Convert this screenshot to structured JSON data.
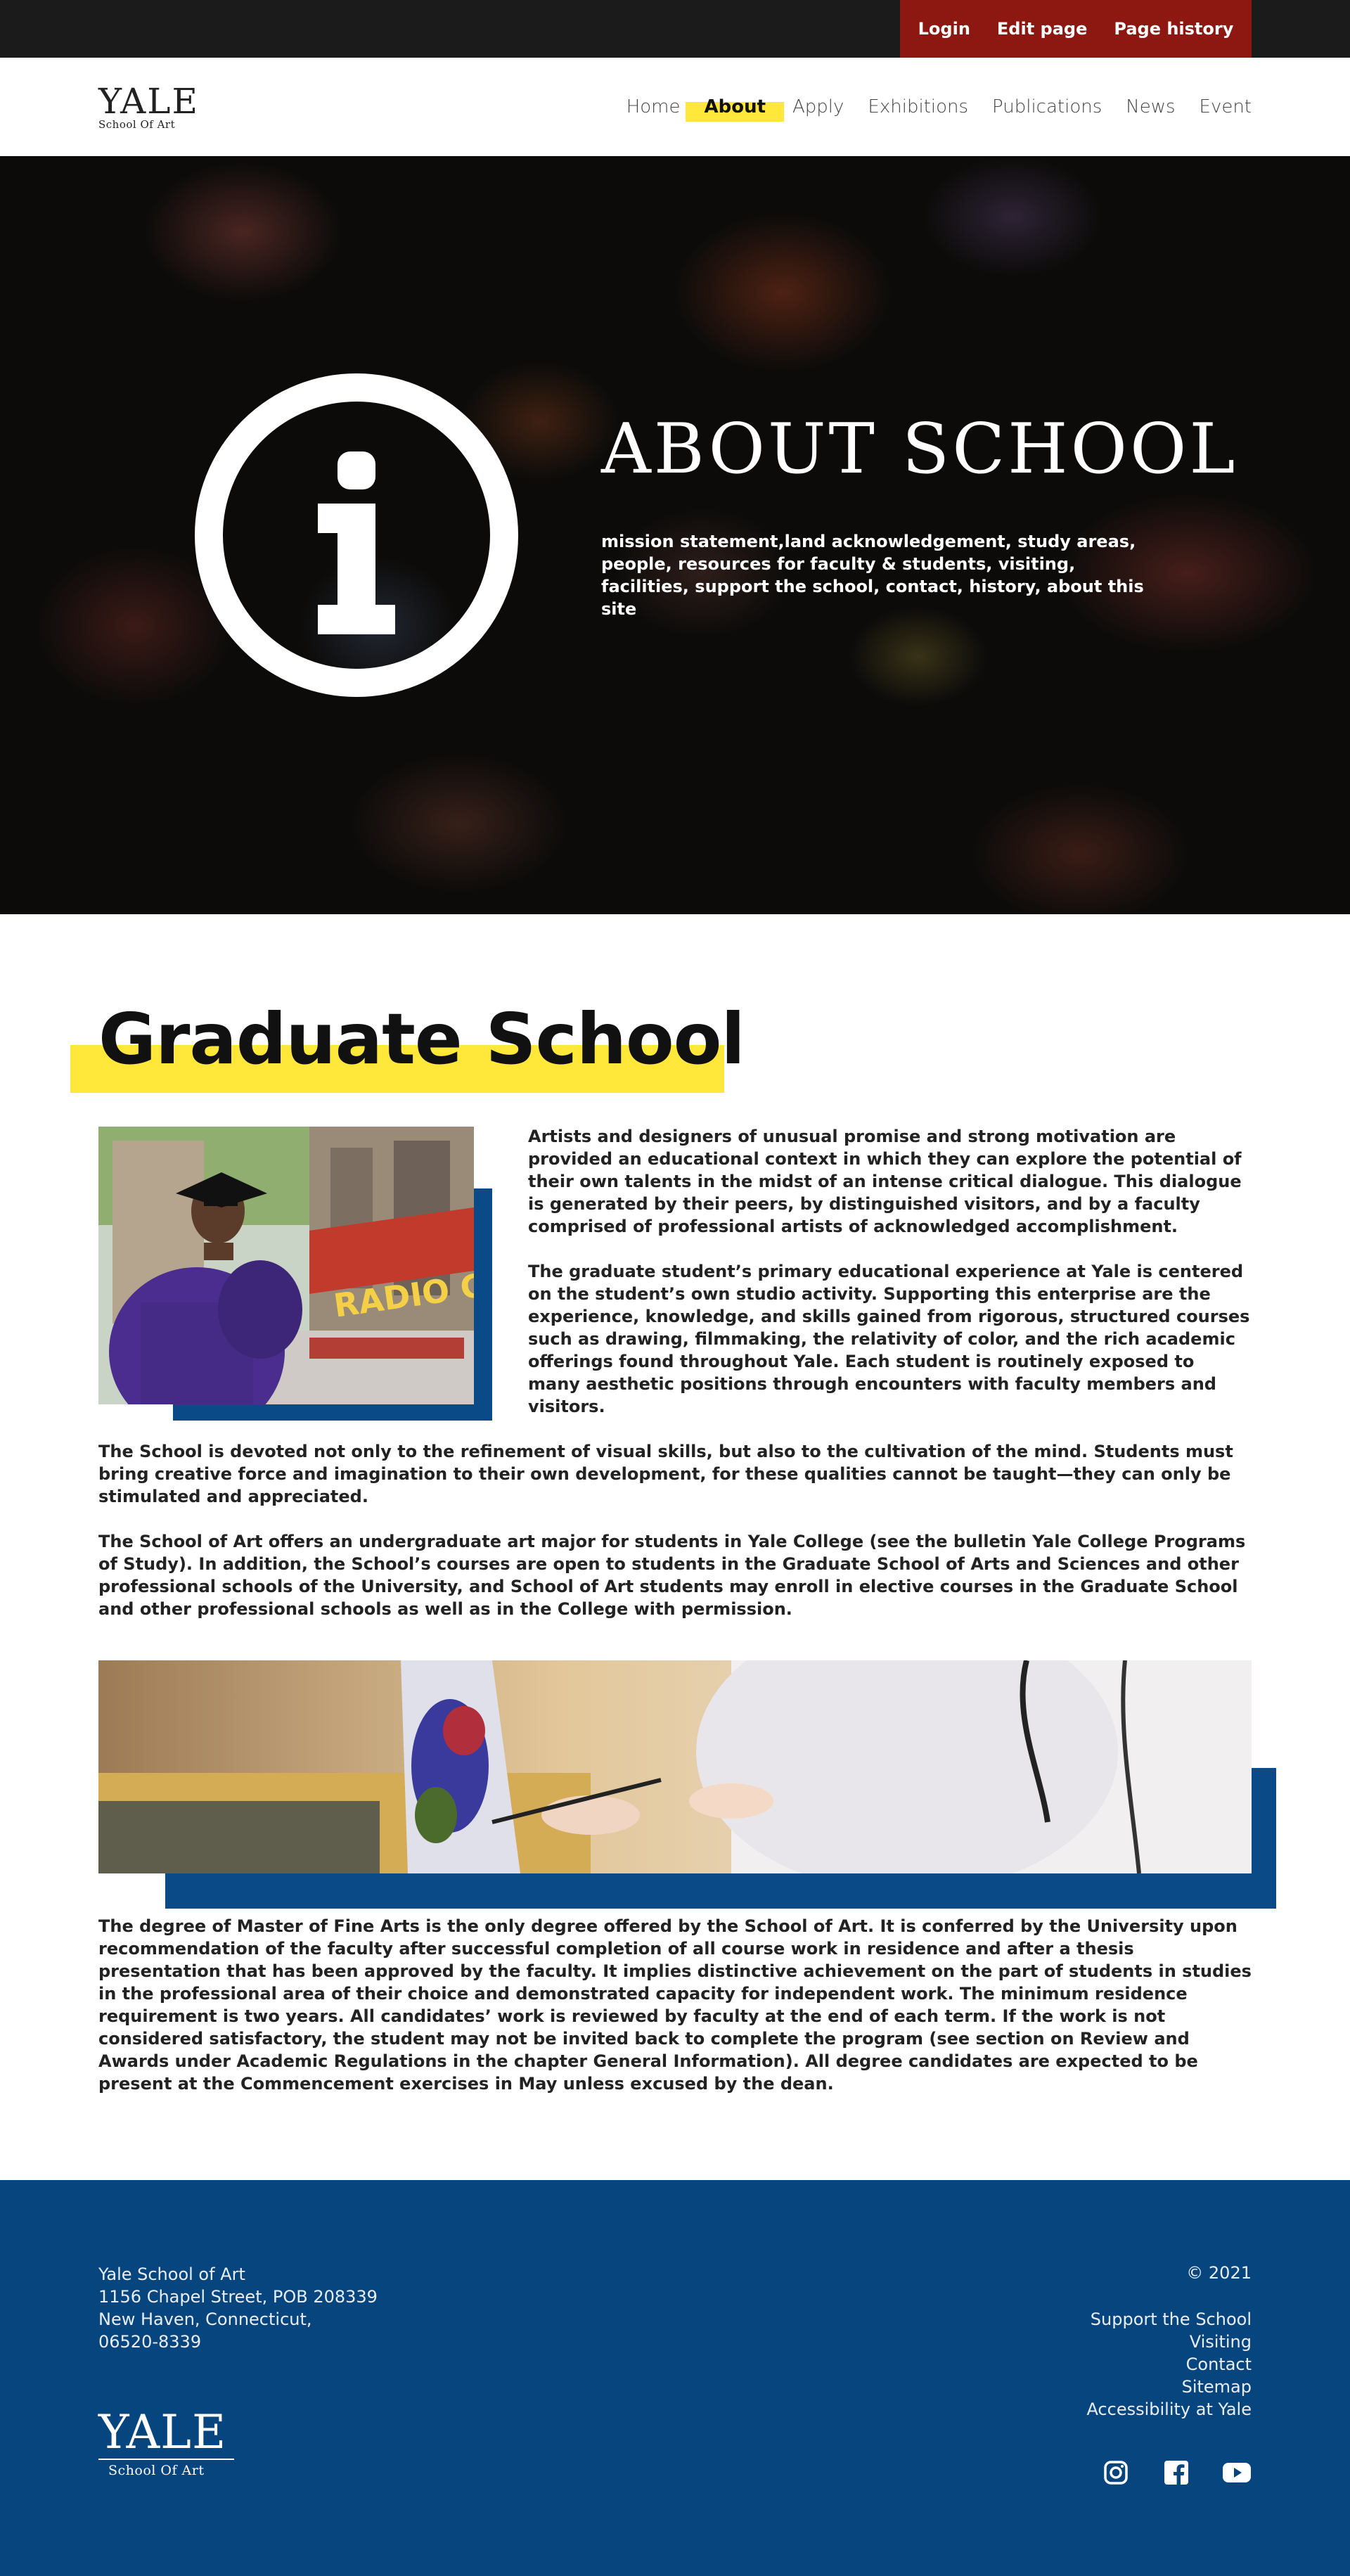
{
  "admin": {
    "login": "Login",
    "edit_page": "Edit page",
    "page_history": "Page history"
  },
  "logo": {
    "main": "YALE",
    "sub": "School Of Art"
  },
  "nav": {
    "items": [
      "Home",
      "About",
      "Apply",
      "Exhibitions",
      "Publications",
      "News",
      "Event"
    ],
    "active": "About"
  },
  "hero": {
    "title": "ABOUT SCHOOL",
    "subtitle": "mission statement,land acknowledgement, study areas, people, resources for faculty & students, visiting, facilities, support the school, contact, history, about this site"
  },
  "main": {
    "heading": "Graduate School",
    "para1": "Artists and designers of unusual promise and strong motivation are provided an educational context in which they can explore the potential of their own talents in the midst of an intense critical dialogue. This dialogue is generated by their peers, by distinguished visitors, and by a faculty comprised of professional artists of acknowledged accomplishment.",
    "para2": "The graduate student’s primary educational experience at Yale is centered on the student’s own studio activity. Supporting this enterprise are the experience, knowledge, and skills gained from rigorous, structured courses such as drawing, filmmaking, the relativity of color, and the rich academic offerings found throughout Yale. Each student is routinely exposed to many aesthetic positions through encounters with faculty members and visitors.",
    "para3": " The School is devoted not only to the refinement of visual skills, but also to the cultivation of the mind. Students must bring creative force and imagination to their own development, for these qualities cannot be taught—they can only be stimulated and appreciated.",
    "para4": "The School of Art offers an undergraduate art major for students in Yale College (see the bulletin Yale College Programs of Study). In addition, the School’s courses are open to students in the Graduate School of Arts and Sciences and other professional schools of the University, and School of Art students may enroll in elective courses in the Graduate School and other professional schools as well as in the College with permission.",
    "para5": "The degree of Master of Fine Arts is the only degree offered by the School of Art. It is conferred by the University upon recommendation of the faculty after successful completion of all course work in residence and after a thesis presentation that has been approved by the faculty. It implies distinctive achievement on the part of students in studies in the professional area of their choice and demonstrated capacity for independent work. The minimum residence requirement is two years. All candidates’ work is reviewed by faculty at the end of each term. If the work is not considered satisfactory, the student may not be invited back to complete the program (see section on Review and Awards under Academic Regulations in the chapter General Information). All degree candidates are expected to be present at the Commencement exercises in May unless excused by the dean.",
    "graduate_photo_sign": "RADIO CI"
  },
  "footer": {
    "address": [
      "Yale School of Art",
      "1156 Chapel Street, POB 208339",
      "New Haven, Connecticut,",
      "06520-8339"
    ],
    "copyright": "© 2021",
    "links": [
      "Support the School",
      "Visiting",
      "Contact",
      "Sitemap",
      "Accessibility at Yale"
    ],
    "logo_main": "YALE",
    "logo_sub": "School Of Art",
    "social": [
      "instagram-icon",
      "facebook-icon",
      "youtube-icon"
    ]
  },
  "colors": {
    "topbar": "#1b1b1b",
    "admin_red": "#8d1812",
    "highlight_yellow": "#ffe83a",
    "navy": "#07457f"
  }
}
